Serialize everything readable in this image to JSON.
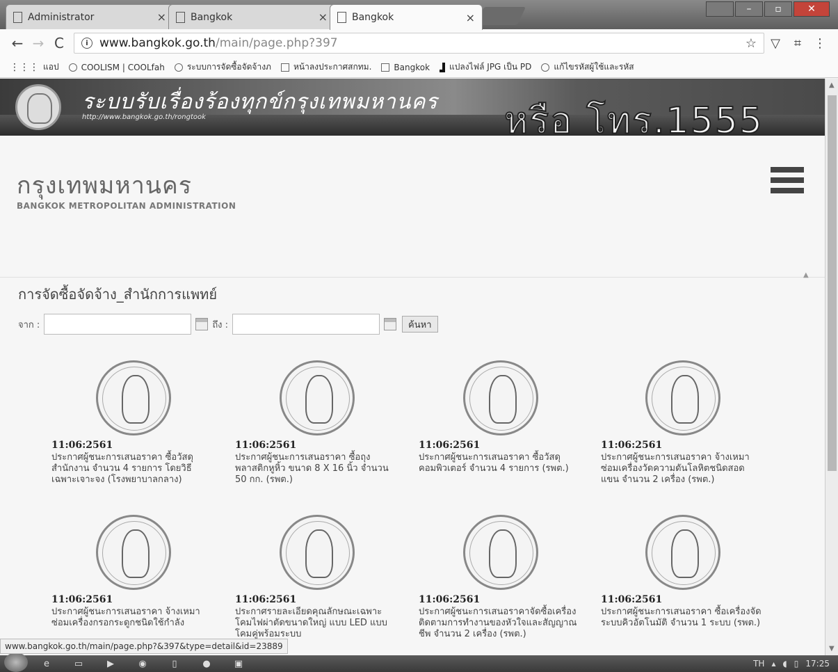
{
  "browser": {
    "tabs": [
      {
        "label": "Administrator",
        "close": "×"
      },
      {
        "label": "Bangkok",
        "close": "×"
      },
      {
        "label": "Bangkok",
        "close": "×"
      }
    ],
    "address": {
      "host": "www.bangkok.go.th",
      "path": "/main/page.php?397"
    },
    "bookmarks": [
      "แอป",
      "COOLISM | COOLfah",
      "ระบบการจัดซื้อจัดจ้างภ",
      "หน้าลงประกาศสกทม.",
      "Bangkok",
      "แปลงไฟล์ JPG เป็น PD",
      "แก้ไขรหัสผู้ใช้และรหัส"
    ]
  },
  "banner": {
    "title": "ระบบรับเรื่องร้องทุกข์กรุงเทพมหานคร",
    "url": "http://www.bangkok.go.th/rongtook",
    "phone": "หรือ โทร.1555"
  },
  "header": {
    "logo_th": "กรุงเทพมหานคร",
    "logo_en": "BANGKOK METROPOLITAN ADMINISTRATION"
  },
  "page": {
    "title": "การจัดซื้อจัดจ้าง_สำนักการแพทย์",
    "from_label": "จาก :",
    "to_label": "ถึง :",
    "search_label": "ค้นหา"
  },
  "items": [
    {
      "date": "11:06:2561",
      "desc": "ประกาศผู้ชนะการเสนอราคา ซื้อวัสดุสำนักงาน จำนวน 4 รายการ โดยวิธีเฉพาะเจาะจง (โรงพยาบาลกลาง)"
    },
    {
      "date": "11:06:2561",
      "desc": "ประกาศผู้ชนะการเสนอราคา ซื้อถุงพลาสติกหูหิ้ว ขนาด 8 X 16 นิ้ว จำนวน 50 กก. (รพต.)"
    },
    {
      "date": "11:06:2561",
      "desc": "ประกาศผู้ชนะการเสนอราคา ซื้อวัสดุคอมพิวเตอร์ จำนวน 4 รายการ (รพต.)"
    },
    {
      "date": "11:06:2561",
      "desc": "ประกาศผู้ชนะการเสนอราคา จ้างเหมาซ่อมเครื่องวัดความดันโลหิตชนิดสอดแขน จำนวน 2 เครื่อง (รพต.)"
    },
    {
      "date": "11:06:2561",
      "desc": "ประกาศผู้ชนะการเสนอราคา จ้างเหมาซ่อมเครื่องกรอกระดูกชนิดใช้กำลัง"
    },
    {
      "date": "11:06:2561",
      "desc": "ประกาศรายละเอียดคุณลักษณะเฉพาะโคมไฟผ่าตัดขนาดใหญ่ แบบ LED แบบโคมคู่พร้อมระบบ"
    },
    {
      "date": "11:06:2561",
      "desc": "ประกาศผู้ชนะการเสนอราคาจัดซื้อเครื่องติดตามการทำงานของหัวใจและสัญญาณชีพ จำนวน 2 เครื่อง (รพต.)"
    },
    {
      "date": "11:06:2561",
      "desc": "ประกาศผู้ชนะการเสนอราคา ซื้อเครื่องจัดระบบคิวอัตโนมัติ จำนวน 1 ระบบ (รพต.)"
    }
  ],
  "status_url": "www.bangkok.go.th/main/page.php?&397&type=detail&id=23889",
  "taskbar": {
    "lang": "TH",
    "time": "17:25"
  }
}
